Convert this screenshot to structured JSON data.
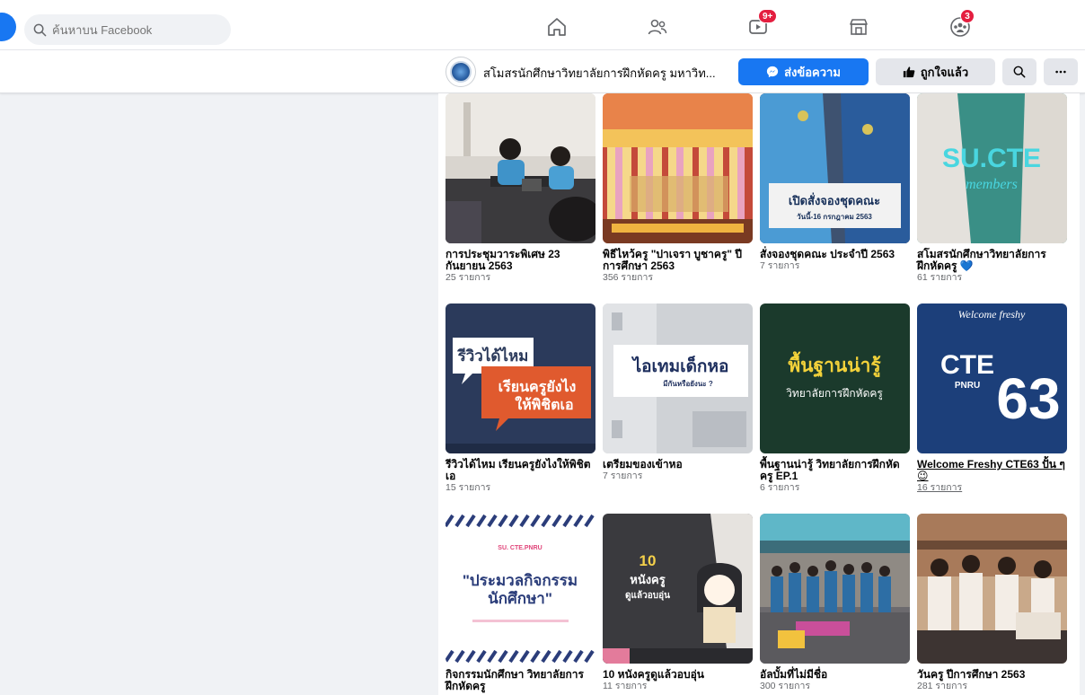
{
  "search": {
    "placeholder": "ค้นหาบน Facebook"
  },
  "nav": {
    "watch_badge": "9+",
    "groups_badge": "3"
  },
  "page": {
    "name": "สโมสรนักศึกษาวิทยาลัยการฝึกหัดครู มหาวิท...",
    "message_button": "ส่งข้อความ",
    "liked_button": "ถูกใจแล้ว"
  },
  "albums": [
    {
      "title": "การประชุมวาระพิเศษ 23 กันยายน 2563",
      "count": "25 รายการ"
    },
    {
      "title": "พิธีไหว้ครู \"ปาเจรา บูชาครู\" ปีการศึกษา 2563",
      "count": "356 รายการ"
    },
    {
      "title": "สั่งจองชุดคณะ ประจำปี 2563",
      "count": "7 รายการ"
    },
    {
      "title": "สโมสรนักศึกษาวิทยาลัยการฝึกหัดครู 💙",
      "count": "61 รายการ"
    },
    {
      "title": "รีวิวได้ไหม เรียนครูยังไงให้พิชิตเอ",
      "count": "15 รายการ"
    },
    {
      "title": "เตรียมของเข้าหอ",
      "count": "7 รายการ"
    },
    {
      "title": "พื้นฐานน่ารู้ วิทยาลัยการฝึกหัดครู EP.1",
      "count": "6 รายการ"
    },
    {
      "title": "Welcome Freshy CTE63 ปั้น ๆ 😉",
      "count": "16 รายการ"
    },
    {
      "title": "กิจกรรมนักศึกษา วิทยาลัยการฝึกหัดครู",
      "count": ""
    },
    {
      "title": "10 หนังครูดูแล้วอบอุ่น",
      "count": "11 รายการ"
    },
    {
      "title": "อัลบั้มที่ไม่มีชื่อ",
      "count": "300 รายการ"
    },
    {
      "title": "วันครู ปีการศึกษา 2563",
      "count": "281 รายการ"
    }
  ],
  "thumb_text": {
    "t3_line1": "เปิดสั่งจองชุดคณะ",
    "t3_line2": "วันนี้-16 กรกฎาคม 2563",
    "t4_line1": "SU.CTE",
    "t4_line2": "members",
    "t5_line1": "รีวิวได้ไหม",
    "t5_line2": "เรียนครูยังไง",
    "t5_line3": "ให้พิชิตเอ",
    "t6_line1": "ไอเทมเด็กหอ",
    "t6_line2": "มีกันหรือยังนะ ?",
    "t7_line1": "พื้นฐานน่ารู้",
    "t7_line2": "วิทยาลัยการฝึกหัดครู",
    "t8_line1": "Welcome freshy",
    "t8_line2": "CTE",
    "t8_line3": "PNRU",
    "t8_line4": "63",
    "t9_line1": "SU. CTE.PNRU",
    "t9_line2": "\"ประมวลกิจกรรม",
    "t9_line3": "นักศึกษา\"",
    "t10_line1": "10",
    "t10_line2": "หนังครู",
    "t10_line3": "ดูแล้วอบอุ่น"
  },
  "colors": {
    "brand": "#1877f2",
    "badge": "#e41e3f",
    "panel": "#ffffff",
    "background": "#f0f2f5"
  }
}
